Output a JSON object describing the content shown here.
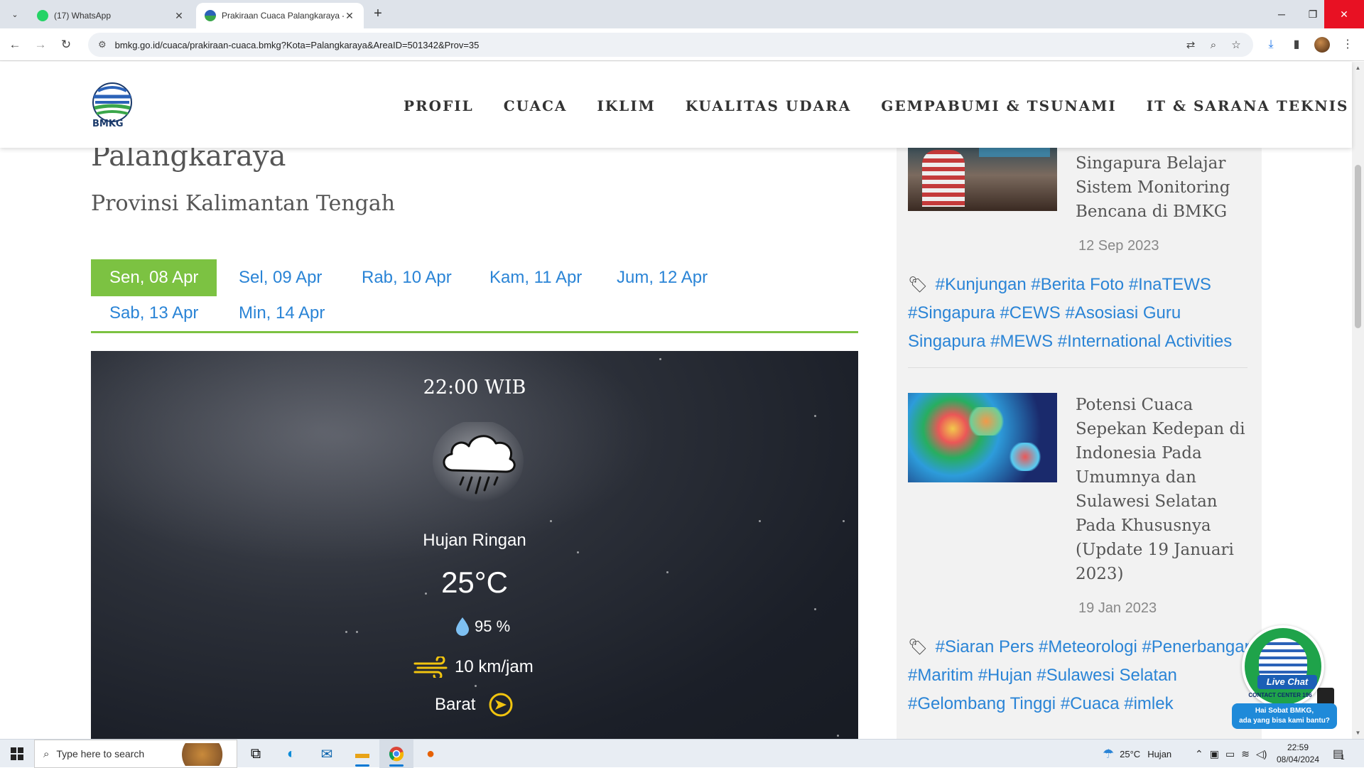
{
  "browser": {
    "tabs": [
      {
        "title": "(17) WhatsApp",
        "active": false
      },
      {
        "title": "Prakiraan Cuaca Palangkaraya -",
        "active": true
      }
    ],
    "url": "bmkg.go.id/cuaca/prakiraan-cuaca.bmkg?Kota=Palangkaraya&AreaID=501342&Prov=35"
  },
  "header": {
    "logo_text": "BMKG",
    "nav": [
      "PROFIL",
      "CUACA",
      "IKLIM",
      "KUALITAS UDARA",
      "GEMPABUMI & TSUNAMI",
      "IT & SARANA TEKNIS"
    ]
  },
  "location": {
    "city": "Palangkaraya",
    "province": "Provinsi Kalimantan Tengah"
  },
  "days": [
    {
      "label": "Sen, 08 Apr",
      "selected": true
    },
    {
      "label": "Sel, 09 Apr",
      "selected": false
    },
    {
      "label": "Rab, 10 Apr",
      "selected": false
    },
    {
      "label": "Kam, 11 Apr",
      "selected": false
    },
    {
      "label": "Jum, 12 Apr",
      "selected": false
    },
    {
      "label": "Sab, 13 Apr",
      "selected": false
    },
    {
      "label": "Min, 14 Apr",
      "selected": false
    }
  ],
  "forecast": {
    "time": "22:00 WIB",
    "condition": "Hujan Ringan",
    "temperature": "25°C",
    "humidity": "95 %",
    "wind_speed": "10 km/jam",
    "wind_direction": "Barat"
  },
  "sidebar": {
    "news": [
      {
        "title": "Singapura Belajar Sistem Monitoring Bencana di BMKG",
        "date": "12 Sep 2023",
        "tags": [
          "#Kunjungan",
          "#Berita Foto",
          "#InaTEWS",
          "#Singapura",
          "#CEWS",
          "#Asosiasi Guru Singapura",
          "#MEWS",
          "#International Activities"
        ]
      },
      {
        "title": "Potensi Cuaca Sepekan Kedepan di Indonesia Pada Umumnya dan Sulawesi Selatan Pada Khususnya (Update 19 Januari 2023)",
        "date": "19 Jan 2023",
        "tags": [
          "#Siaran Pers",
          "#Meteorologi",
          "#Penerbangan",
          "#Maritim",
          "#Hujan",
          "#Sulawesi Selatan",
          "#Gelombang Tinggi",
          "#Cuaca",
          "#imlek"
        ]
      }
    ]
  },
  "livechat": {
    "label": "Live Chat",
    "sub": "CONTACT CENTER 196",
    "bubble_line1": "Hai Sobat BMKG,",
    "bubble_line2": "ada yang bisa kami bantu?"
  },
  "taskbar": {
    "search_placeholder": "Type here to search",
    "weather_temp": "25°C",
    "weather_text": "Hujan",
    "time": "22:59",
    "date": "08/04/2024",
    "notification_count": "1"
  },
  "colors": {
    "accent_green": "#7cc242",
    "link_blue": "#2a84d6",
    "close_red": "#e81123"
  }
}
